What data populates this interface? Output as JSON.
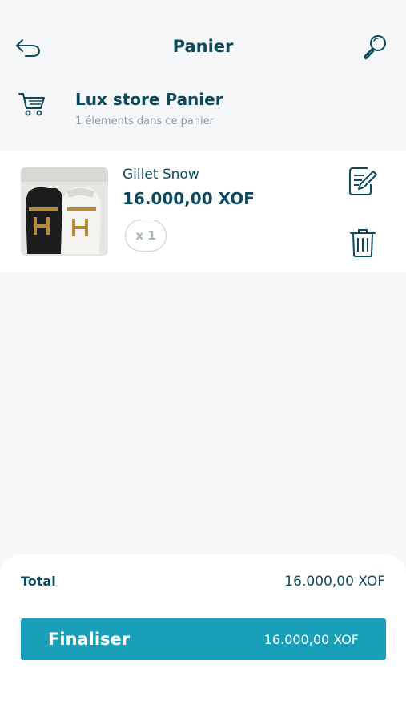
{
  "header": {
    "title": "Panier",
    "back_icon": "back-arrow-icon",
    "search_icon": "search-icon"
  },
  "store": {
    "icon": "shopping-cart-icon",
    "name": "Lux store Panier",
    "subtitle": "1 élements dans ce panier"
  },
  "items": [
    {
      "name": "Gillet Snow",
      "price": "16.000,00  XOF",
      "quantity": "x 1",
      "thumbnail": "product-image",
      "edit_icon": "edit-icon",
      "delete_icon": "trash-icon"
    }
  ],
  "summary": {
    "total_label": "Total",
    "total_value": "16.000,00  XOF"
  },
  "checkout": {
    "label": "Finaliser",
    "amount": "16.000,00  XOF"
  },
  "colors": {
    "primary_text": "#0f4a5c",
    "accent": "#1a9fb8",
    "background": "#f6f7f8",
    "muted_text": "#8d9aa0"
  }
}
